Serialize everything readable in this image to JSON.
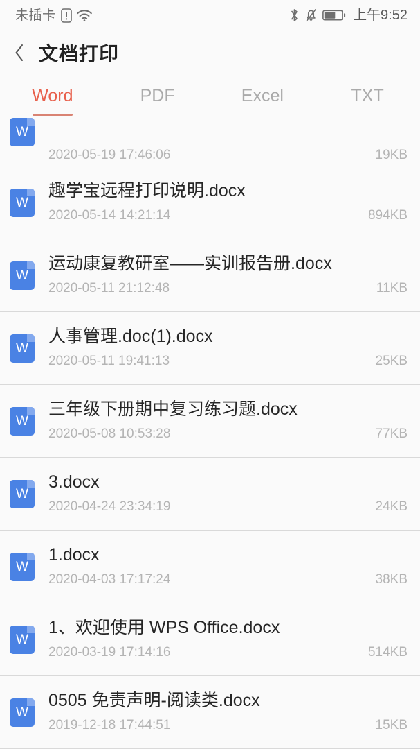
{
  "status_bar": {
    "carrier_text": "未插卡",
    "sim_icon": "sim-alert-icon",
    "wifi_icon": "wifi-icon",
    "bluetooth_icon": "bluetooth-icon",
    "mute_icon": "bell-muted-icon",
    "battery_icon": "battery-icon",
    "battery_level": 60,
    "clock": "上午9:52"
  },
  "header": {
    "back_icon": "chevron-left-icon",
    "title": "文档打印"
  },
  "tabs": [
    {
      "label": "Word",
      "active": true
    },
    {
      "label": "PDF",
      "active": false
    },
    {
      "label": "Excel",
      "active": false
    },
    {
      "label": "TXT",
      "active": false
    }
  ],
  "colors": {
    "accent": "#e8614d",
    "tab_underline": "#d98373",
    "tab_inactive": "#aaaaaa",
    "icon_blue": "#4a82e4",
    "background": "#fafafa",
    "divider": "#d9d9d9",
    "filename": "#262626",
    "meta_gray": "#b4b4b4"
  },
  "file_list": [
    {
      "icon": "word-file-icon",
      "icon_glyph": "W",
      "name": "",
      "date": "2020-05-19 17:46:06",
      "size": "19KB",
      "clipped": true
    },
    {
      "icon": "word-file-icon",
      "icon_glyph": "W",
      "name": "趣学宝远程打印说明.docx",
      "date": "2020-05-14 14:21:14",
      "size": "894KB",
      "clipped": false
    },
    {
      "icon": "word-file-icon",
      "icon_glyph": "W",
      "name": "运动康复教研室——实训报告册.docx",
      "date": "2020-05-11 21:12:48",
      "size": "11KB",
      "clipped": false
    },
    {
      "icon": "word-file-icon",
      "icon_glyph": "W",
      "name": "人事管理.doc(1).docx",
      "date": "2020-05-11 19:41:13",
      "size": "25KB",
      "clipped": false
    },
    {
      "icon": "word-file-icon",
      "icon_glyph": "W",
      "name": "三年级下册期中复习练习题.docx",
      "date": "2020-05-08 10:53:28",
      "size": "77KB",
      "clipped": false
    },
    {
      "icon": "word-file-icon",
      "icon_glyph": "W",
      "name": "3.docx",
      "date": "2020-04-24 23:34:19",
      "size": "24KB",
      "clipped": false
    },
    {
      "icon": "word-file-icon",
      "icon_glyph": "W",
      "name": "1.docx",
      "date": "2020-04-03 17:17:24",
      "size": "38KB",
      "clipped": false
    },
    {
      "icon": "word-file-icon",
      "icon_glyph": "W",
      "name": "1、欢迎使用 WPS Office.docx",
      "date": "2020-03-19 17:14:16",
      "size": "514KB",
      "clipped": false
    },
    {
      "icon": "word-file-icon",
      "icon_glyph": "W",
      "name": "0505 免责声明-阅读类.docx",
      "date": "2019-12-18 17:44:51",
      "size": "15KB",
      "clipped": false
    }
  ]
}
